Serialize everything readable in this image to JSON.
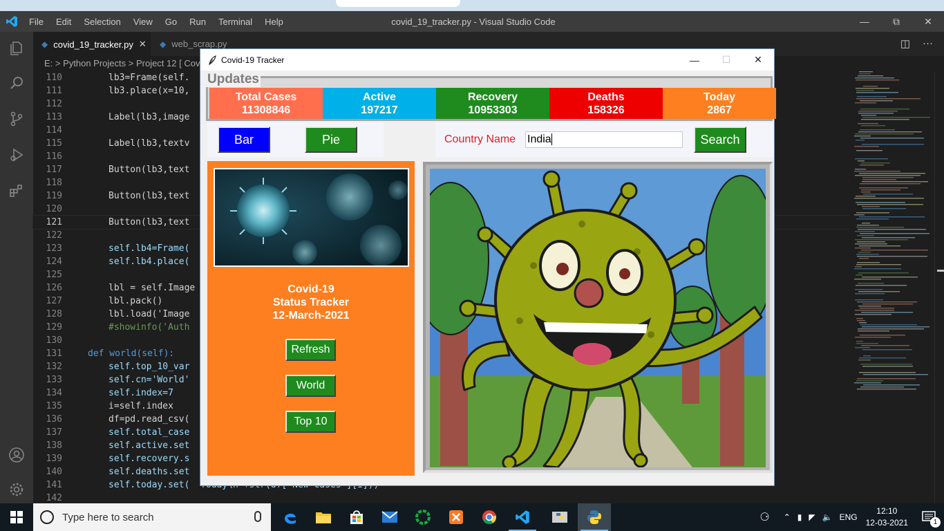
{
  "vscode": {
    "menu": [
      "File",
      "Edit",
      "Selection",
      "View",
      "Go",
      "Run",
      "Terminal",
      "Help"
    ],
    "window_title": "covid_19_tracker.py - Visual Studio Code",
    "tabs": [
      {
        "label": "covid_19_tracker.py",
        "active": true
      },
      {
        "label": "web_scrap.py",
        "active": false
      }
    ],
    "breadcrumb": "E: > Python Projects > Project 12 [ Covi",
    "current_line": 121,
    "lines": [
      {
        "n": "110",
        "code": "lb3=Frame(self."
      },
      {
        "n": "111",
        "code": "lb3.place(x=10,"
      },
      {
        "n": "112",
        "code": ""
      },
      {
        "n": "113",
        "code": "Label(lb3,image"
      },
      {
        "n": "114",
        "code": ""
      },
      {
        "n": "115",
        "code": "Label(lb3,textv"
      },
      {
        "n": "116",
        "code": ""
      },
      {
        "n": "117",
        "code": "Button(lb3,text"
      },
      {
        "n": "118",
        "code": ""
      },
      {
        "n": "119",
        "code": "Button(lb3,text"
      },
      {
        "n": "120",
        "code": ""
      },
      {
        "n": "121",
        "code": "Button(lb3,text"
      },
      {
        "n": "122",
        "code": ""
      },
      {
        "n": "123",
        "code": "self.lb4=Frame("
      },
      {
        "n": "124",
        "code": "self.lb4.place("
      },
      {
        "n": "125",
        "code": ""
      },
      {
        "n": "126",
        "code": "lbl = self.Image"
      },
      {
        "n": "127",
        "code": "lbl.pack()"
      },
      {
        "n": "128",
        "code": "lbl.load('Image"
      },
      {
        "n": "129",
        "code": "#showinfo('Auth"
      },
      {
        "n": "130",
        "code": ""
      },
      {
        "n": "131",
        "code": "def world(self):"
      },
      {
        "n": "132",
        "code": "self.top_10_var"
      },
      {
        "n": "133",
        "code": "self.cn='World'"
      },
      {
        "n": "134",
        "code": "self.index=7"
      },
      {
        "n": "135",
        "code": "i=self.index"
      },
      {
        "n": "136",
        "code": "df=pd.read_csv("
      },
      {
        "n": "137",
        "code": "self.total_case"
      },
      {
        "n": "138",
        "code": "self.active.set"
      },
      {
        "n": "139",
        "code": "self.recovery.s"
      },
      {
        "n": "140",
        "code": "self.deaths.set"
      },
      {
        "n": "141",
        "code": "self.today.set(  Today\\n'+str(df['New Cases'][i]))"
      },
      {
        "n": "142",
        "code": ""
      }
    ]
  },
  "app": {
    "window_title": "Covid-19 Tracker",
    "updates_title": "Updates",
    "stats": [
      {
        "label": "Total Cases",
        "value": "11308846",
        "color": "#ff6f4e"
      },
      {
        "label": "Active",
        "value": "197217",
        "color": "#00b0e8"
      },
      {
        "label": "Recovery",
        "value": "10953303",
        "color": "#1f8b1e"
      },
      {
        "label": "Deaths",
        "value": "158326",
        "color": "#ee0000"
      },
      {
        "label": "Today",
        "value": "2867",
        "color": "#fd7f20"
      }
    ],
    "buttons": {
      "bar": "Bar",
      "pie": "Pie",
      "search": "Search",
      "refresh": "Refresh",
      "world": "World",
      "top10": "Top 10"
    },
    "country_label": "Country Name",
    "country_value": "India",
    "tracker_title": "Covid-19",
    "tracker_subtitle": "Status Tracker",
    "tracker_date": "12-March-2021"
  },
  "taskbar": {
    "search_placeholder": "Type here to search",
    "language": "ENG",
    "time": "12:10",
    "date": "12-03-2021",
    "notifications": "1"
  },
  "colors": {
    "accent": "#007acc",
    "orange": "#fd7f20",
    "tk_green": "#1f8b1e",
    "tk_blue": "#0000ff"
  }
}
